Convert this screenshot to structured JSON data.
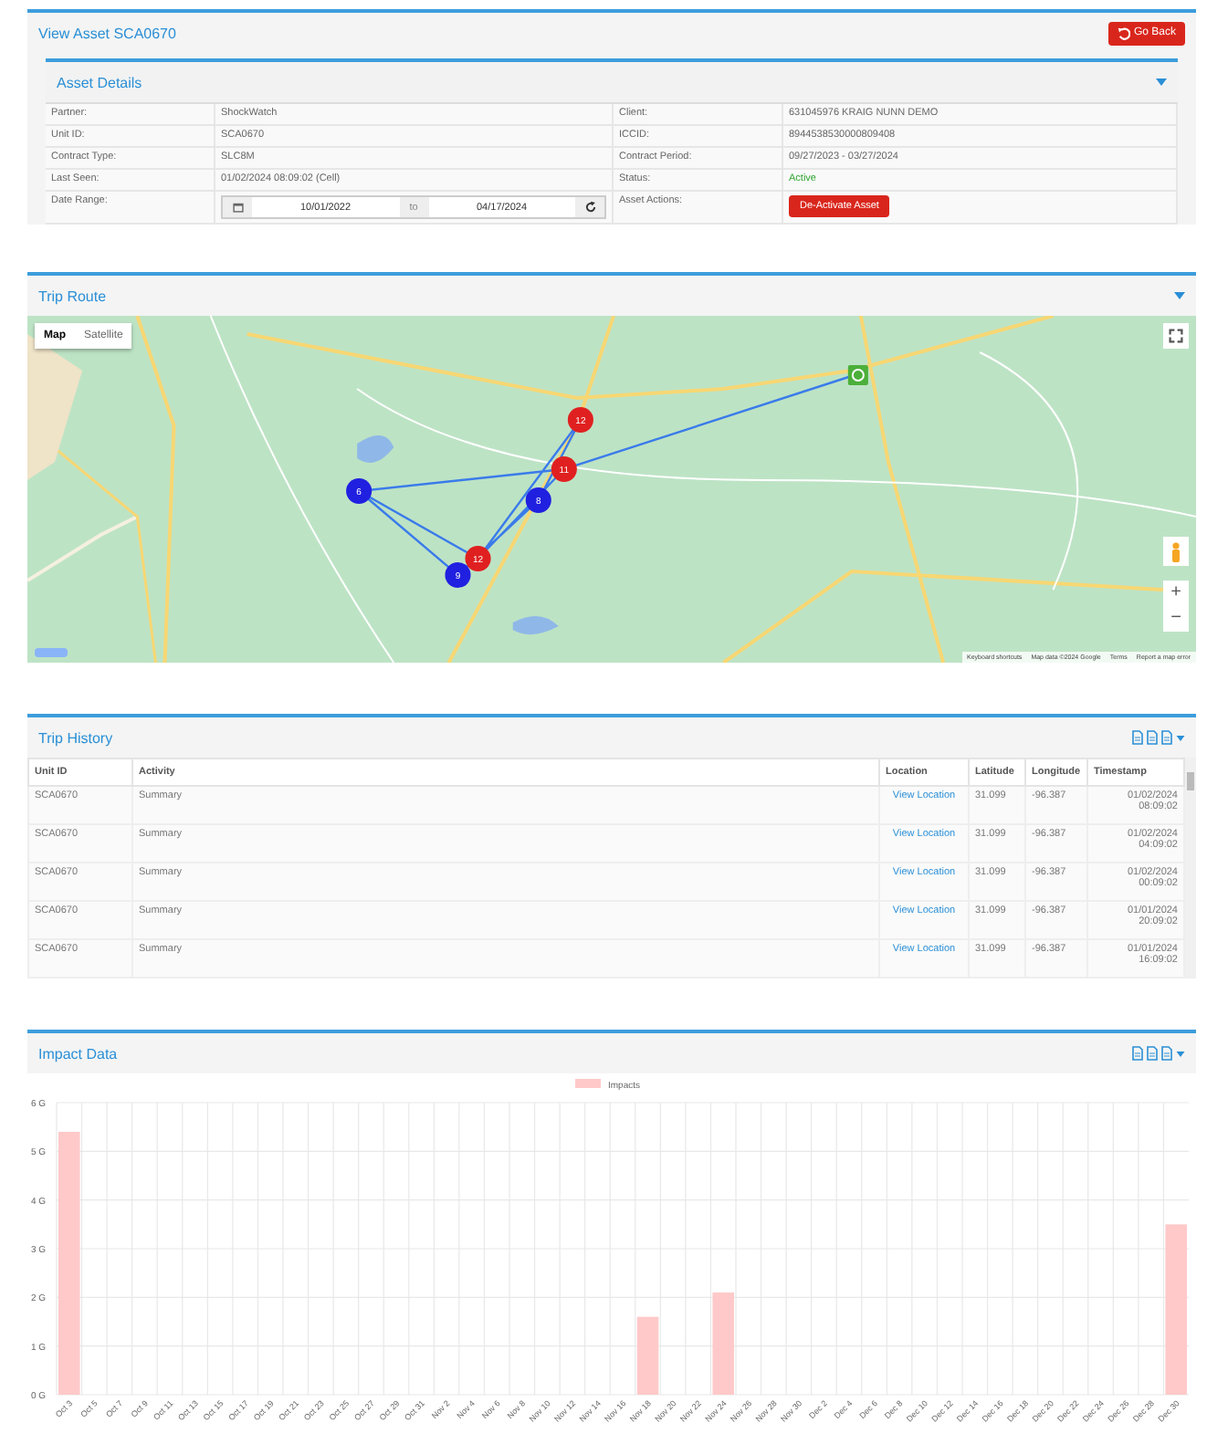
{
  "header": {
    "title": "View Asset SCA0670",
    "back_button": "Go Back"
  },
  "asset_details": {
    "title": "Asset Details",
    "rows": [
      {
        "left": {
          "label": "Partner:",
          "kind": "text",
          "value": "ShockWatch"
        },
        "right": {
          "label": "Client:",
          "kind": "text",
          "value": "631045976 KRAIG NUNN DEMO"
        }
      },
      {
        "left": {
          "label": "Unit ID:",
          "kind": "text",
          "value": "SCA0670"
        },
        "right": {
          "label": "ICCID:",
          "kind": "text",
          "value": "8944538530000809408"
        }
      },
      {
        "left": {
          "label": "Contract Type:",
          "kind": "text",
          "value": "SLC8M"
        },
        "right": {
          "label": "Contract Period:",
          "kind": "text",
          "value": "09/27/2023 - 03/27/2024"
        }
      },
      {
        "left": {
          "label": "Last Seen:",
          "kind": "text",
          "value": "01/02/2024 08:09:02 (Cell)"
        },
        "right": {
          "label": "Status:",
          "kind": "status",
          "value": "Active"
        }
      },
      {
        "left": {
          "label": "Date Range:",
          "kind": "date_range",
          "from": "10/01/2022",
          "separator": "to",
          "to": "04/17/2024"
        },
        "right": {
          "label": "Asset Actions:",
          "kind": "button",
          "value": "De-Activate Asset"
        }
      }
    ]
  },
  "trip_route": {
    "title": "Trip Route",
    "map_types": [
      {
        "label": "Map",
        "selected": true
      },
      {
        "label": "Satellite",
        "selected": false
      }
    ],
    "markers": [
      {
        "count": "6",
        "color": "#2020e0"
      },
      {
        "count": "9",
        "color": "#2020e0"
      },
      {
        "count": "8",
        "color": "#2020e0"
      },
      {
        "count": "11",
        "color": "#e02020"
      },
      {
        "count": "12",
        "color": "#e02020"
      },
      {
        "count": "12",
        "color": "#e02020"
      }
    ],
    "zoom_in": "+",
    "zoom_out": "−",
    "attribution": [
      "Keyboard shortcuts",
      "Map data ©2024 Google",
      "Terms",
      "Report a map error"
    ]
  },
  "trip_history": {
    "title": "Trip History",
    "columns": [
      "Unit ID",
      "Activity",
      "Location",
      "Latitude",
      "Longitude",
      "Timestamp"
    ],
    "rows": [
      {
        "unit_id": "SCA0670",
        "activity": "Summary",
        "location": "View Location",
        "latitude": "31.099",
        "longitude": "-96.387",
        "timestamp": "01/02/2024 08:09:02"
      },
      {
        "unit_id": "SCA0670",
        "activity": "Summary",
        "location": "View Location",
        "latitude": "31.099",
        "longitude": "-96.387",
        "timestamp": "01/02/2024 04:09:02"
      },
      {
        "unit_id": "SCA0670",
        "activity": "Summary",
        "location": "View Location",
        "latitude": "31.099",
        "longitude": "-96.387",
        "timestamp": "01/02/2024 00:09:02"
      },
      {
        "unit_id": "SCA0670",
        "activity": "Summary",
        "location": "View Location",
        "latitude": "31.099",
        "longitude": "-96.387",
        "timestamp": "01/01/2024 20:09:02"
      },
      {
        "unit_id": "SCA0670",
        "activity": "Summary",
        "location": "View Location",
        "latitude": "31.099",
        "longitude": "-96.387",
        "timestamp": "01/01/2024 16:09:02"
      }
    ]
  },
  "impact_data": {
    "title": "Impact Data",
    "chart_data": {
      "type": "bar",
      "categories": [
        "Oct 3",
        "Oct 5",
        "Oct 7",
        "Oct 9",
        "Oct 11",
        "Oct 13",
        "Oct 15",
        "Oct 17",
        "Oct 19",
        "Oct 21",
        "Oct 23",
        "Oct 25",
        "Oct 27",
        "Oct 29",
        "Oct 31",
        "Nov 2",
        "Nov 4",
        "Nov 6",
        "Nov 8",
        "Nov 10",
        "Nov 12",
        "Nov 14",
        "Nov 16",
        "Nov 18",
        "Nov 20",
        "Nov 22",
        "Nov 24",
        "Nov 26",
        "Nov 28",
        "Nov 30",
        "Dec 2",
        "Dec 4",
        "Dec 6",
        "Dec 8",
        "Dec 10",
        "Dec 12",
        "Dec 14",
        "Dec 16",
        "Dec 18",
        "Dec 20",
        "Dec 22",
        "Dec 24",
        "Dec 26",
        "Dec 28",
        "Dec 30"
      ],
      "series": [
        {
          "name": "Impacts",
          "color": "#ffc9c9",
          "values": [
            5.4,
            0,
            0,
            0,
            0,
            0,
            0,
            0,
            0,
            0,
            0,
            0,
            0,
            0,
            0,
            0,
            0,
            0,
            0,
            0,
            0,
            0,
            0,
            1.6,
            0,
            0,
            2.1,
            0,
            0,
            0,
            0,
            0,
            0,
            0,
            0,
            0,
            0,
            0,
            0,
            0,
            0,
            0,
            0,
            0,
            3.5
          ]
        }
      ],
      "grid": true,
      "ylim": [
        0,
        6
      ],
      "yticks": [
        {
          "value": 0,
          "label": "0 G"
        },
        {
          "value": 1,
          "label": "1 G"
        },
        {
          "value": 2,
          "label": "2 G"
        },
        {
          "value": 3,
          "label": "3 G"
        },
        {
          "value": 4,
          "label": "4 G"
        },
        {
          "value": 5,
          "label": "5 G"
        },
        {
          "value": 6,
          "label": "6 G"
        }
      ]
    }
  }
}
